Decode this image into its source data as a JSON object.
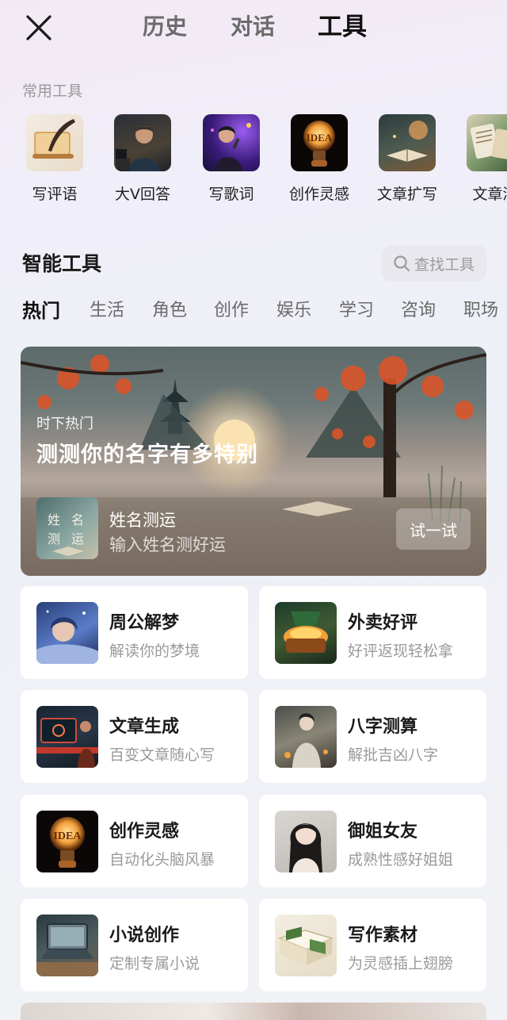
{
  "header": {
    "tabs": [
      {
        "label": "历史",
        "active": false
      },
      {
        "label": "对话",
        "active": false
      },
      {
        "label": "工具",
        "active": true
      }
    ]
  },
  "common": {
    "label": "常用工具",
    "items": [
      {
        "label": "写评语",
        "icon": "quill-scroll-icon"
      },
      {
        "label": "大V回答",
        "icon": "host-portrait-icon"
      },
      {
        "label": "写歌词",
        "icon": "singer-icon"
      },
      {
        "label": "创作灵感",
        "icon": "idea-bulb-icon"
      },
      {
        "label": "文章扩写",
        "icon": "book-scene-icon"
      },
      {
        "label": "文章润",
        "icon": "books-collage-icon"
      }
    ]
  },
  "smart": {
    "title": "智能工具",
    "search_placeholder": "查找工具",
    "categories": [
      {
        "label": "热门",
        "active": true
      },
      {
        "label": "生活",
        "active": false
      },
      {
        "label": "角色",
        "active": false
      },
      {
        "label": "创作",
        "active": false
      },
      {
        "label": "娱乐",
        "active": false
      },
      {
        "label": "学习",
        "active": false
      },
      {
        "label": "咨询",
        "active": false
      },
      {
        "label": "职场",
        "active": false
      }
    ]
  },
  "hero": {
    "kicker": "时下热门",
    "title": "测测你的名字有多特别",
    "tool_name": "姓名测运",
    "tool_sub": "输入姓名测好运",
    "button": "试一试",
    "thumb_text": "姓名测运"
  },
  "tools": [
    {
      "title": "周公解梦",
      "sub": "解读你的梦境"
    },
    {
      "title": "外卖好评",
      "sub": "好评返现轻松拿"
    },
    {
      "title": "文章生成",
      "sub": "百变文章随心写"
    },
    {
      "title": "八字测算",
      "sub": "解批吉凶八字"
    },
    {
      "title": "创作灵感",
      "sub": "自动化头脑风暴"
    },
    {
      "title": "御姐女友",
      "sub": "成熟性感好姐姐"
    },
    {
      "title": "小说创作",
      "sub": "定制专属小说"
    },
    {
      "title": "写作素材",
      "sub": "为灵感插上翅膀"
    }
  ]
}
